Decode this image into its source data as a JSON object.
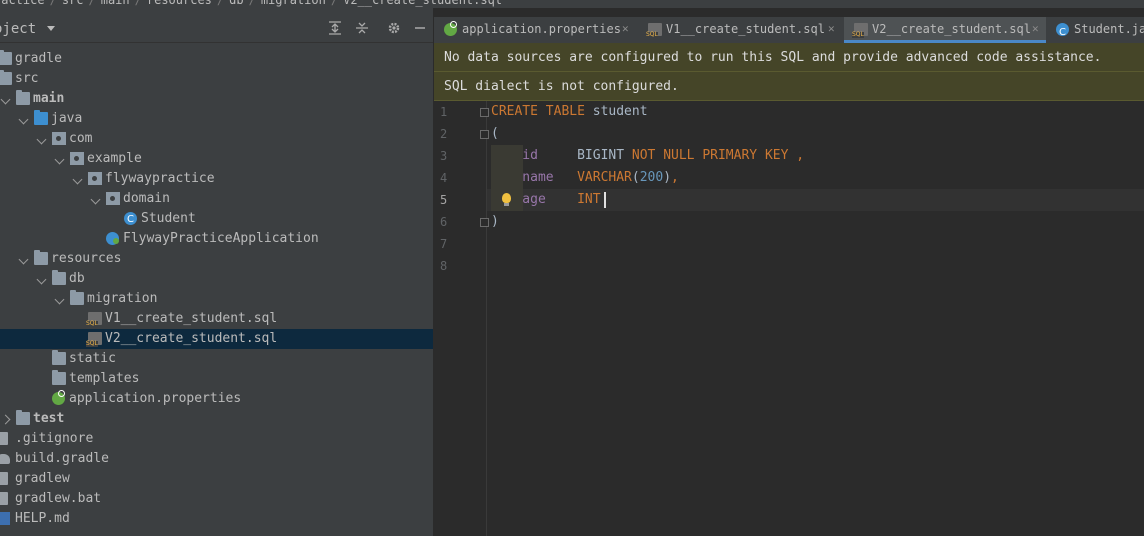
{
  "breadcrumb": [
    "ractice",
    "src",
    "main",
    "resources",
    "db",
    "migration",
    "V2__create_student.sql"
  ],
  "project_panel": {
    "title": "oject",
    "tree": [
      {
        "label": "gradle",
        "icon": "folder",
        "indent": 0,
        "chevron": "right",
        "bold": false
      },
      {
        "label": "src",
        "icon": "folder",
        "indent": 0,
        "chevron": "down",
        "bold": false
      },
      {
        "label": "main",
        "icon": "folder",
        "indent": 1,
        "chevron": "down",
        "bold": true
      },
      {
        "label": "java",
        "icon": "folder-blue",
        "indent": 2,
        "chevron": "down",
        "bold": false
      },
      {
        "label": "com",
        "icon": "package",
        "indent": 3,
        "chevron": "down",
        "bold": false
      },
      {
        "label": "example",
        "icon": "package",
        "indent": 4,
        "chevron": "down",
        "bold": false
      },
      {
        "label": "flywaypractice",
        "icon": "package",
        "indent": 5,
        "chevron": "down",
        "bold": false
      },
      {
        "label": "domain",
        "icon": "package",
        "indent": 6,
        "chevron": "down",
        "bold": false
      },
      {
        "label": "Student",
        "icon": "class",
        "indent": 7,
        "chevron": "none",
        "bold": false
      },
      {
        "label": "FlywayPracticeApplication",
        "icon": "spring-app",
        "indent": 6,
        "chevron": "none",
        "bold": false
      },
      {
        "label": "resources",
        "icon": "folder",
        "indent": 2,
        "chevron": "down",
        "bold": false
      },
      {
        "label": "db",
        "icon": "folder",
        "indent": 3,
        "chevron": "down",
        "bold": false
      },
      {
        "label": "migration",
        "icon": "folder",
        "indent": 4,
        "chevron": "down",
        "bold": false
      },
      {
        "label": "V1__create_student.sql",
        "icon": "sql",
        "indent": 5,
        "chevron": "none",
        "bold": false
      },
      {
        "label": "V2__create_student.sql",
        "icon": "sql",
        "indent": 5,
        "chevron": "none",
        "bold": false,
        "selected": true
      },
      {
        "label": "static",
        "icon": "folder",
        "indent": 3,
        "chevron": "none",
        "bold": false
      },
      {
        "label": "templates",
        "icon": "folder",
        "indent": 3,
        "chevron": "none",
        "bold": false
      },
      {
        "label": "application.properties",
        "icon": "spring",
        "indent": 3,
        "chevron": "none",
        "bold": false
      },
      {
        "label": "test",
        "icon": "folder",
        "indent": 1,
        "chevron": "right",
        "bold": true
      },
      {
        "label": ".gitignore",
        "icon": "file",
        "indent": 0,
        "chevron": "none",
        "bold": false
      },
      {
        "label": "build.gradle",
        "icon": "gradle",
        "indent": 0,
        "chevron": "none",
        "bold": false
      },
      {
        "label": "gradlew",
        "icon": "file",
        "indent": 0,
        "chevron": "none",
        "bold": false
      },
      {
        "label": "gradlew.bat",
        "icon": "file",
        "indent": 0,
        "chevron": "none",
        "bold": false
      },
      {
        "label": "HELP.md",
        "icon": "md",
        "indent": 0,
        "chevron": "none",
        "bold": false
      }
    ]
  },
  "tabs": [
    {
      "label": "application.properties",
      "icon": "spring",
      "active": false
    },
    {
      "label": "V1__create_student.sql",
      "icon": "sql",
      "active": false
    },
    {
      "label": "V2__create_student.sql",
      "icon": "sql",
      "active": true
    },
    {
      "label": "Student.ja",
      "icon": "class",
      "active": false
    }
  ],
  "banners": {
    "datasource": "No data sources are configured to run this SQL and provide advanced code assistance.",
    "dialect": "SQL dialect is not configured."
  },
  "editor": {
    "line_numbers": [
      "1",
      "2",
      "3",
      "4",
      "5",
      "6",
      "7",
      "8"
    ],
    "current_line": 5,
    "code": [
      [
        {
          "t": "kw",
          "v": "CREATE TABLE "
        },
        {
          "t": "plain",
          "v": "student"
        }
      ],
      [
        {
          "t": "plain",
          "v": "("
        }
      ],
      [
        {
          "t": "col",
          "v": "    id     "
        },
        {
          "t": "plain",
          "v": "BIGINT "
        },
        {
          "t": "kw",
          "v": "NOT NULL PRIMARY KEY ,"
        }
      ],
      [
        {
          "t": "col",
          "v": "    name   "
        },
        {
          "t": "kw",
          "v": "VARCHAR"
        },
        {
          "t": "plain",
          "v": "("
        },
        {
          "t": "num",
          "v": "200"
        },
        {
          "t": "plain",
          "v": ")"
        },
        {
          "t": "kw",
          "v": ","
        }
      ],
      [
        {
          "t": "col",
          "v": "    age    "
        },
        {
          "t": "kw",
          "v": "INT"
        }
      ],
      [
        {
          "t": "plain",
          "v": ")"
        }
      ],
      [],
      []
    ]
  }
}
